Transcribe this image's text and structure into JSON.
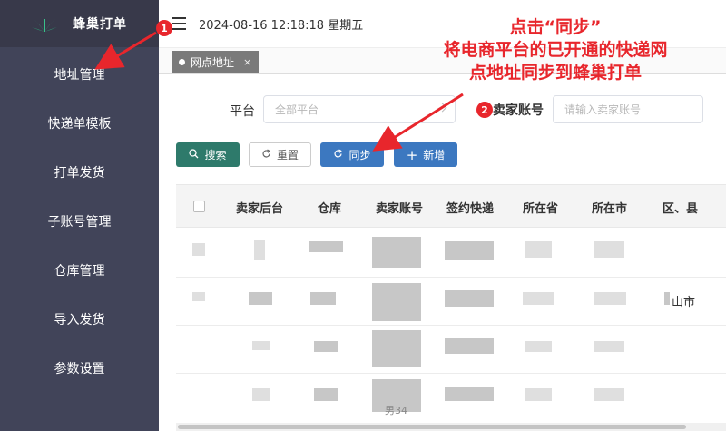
{
  "app": {
    "brand": "蜂巢打单",
    "datetime": "2024-08-16 12:18:18 星期五"
  },
  "sidebar": {
    "items": [
      {
        "label": "地址管理"
      },
      {
        "label": "快递单模板"
      },
      {
        "label": "打单发货"
      },
      {
        "label": "子账号管理"
      },
      {
        "label": "仓库管理"
      },
      {
        "label": "导入发货"
      },
      {
        "label": "参数设置"
      }
    ]
  },
  "tabs": [
    {
      "label": "网点地址",
      "close": "×"
    }
  ],
  "filters": {
    "platform_label": "平台",
    "platform_placeholder": "全部平台",
    "seller_label": "卖家账号",
    "seller_placeholder": "请输入卖家账号"
  },
  "toolbar": {
    "search": "搜索",
    "reset": "重置",
    "sync": "同步",
    "add": "新增"
  },
  "table": {
    "columns": [
      "卖家后台",
      "仓库",
      "卖家账号",
      "签约快递",
      "所在省",
      "所在市",
      "区、县"
    ],
    "rows": [
      {
        "district": ""
      },
      {
        "district": "山市"
      },
      {
        "district": ""
      },
      {
        "district": ""
      }
    ],
    "footer_partial": "男34"
  },
  "annotation": {
    "line1": "点击“同步”",
    "line2": "将电商平台的已开通的快递网",
    "line3": "点地址同步到蜂巢打单",
    "badge1": "1",
    "badge2": "2",
    "color": "#e8262c"
  },
  "colors": {
    "sidebar": "#414459",
    "brand_bg": "#38394a",
    "search_btn": "#2e7a6b",
    "primary_btn": "#3c78c0"
  },
  "icons": {
    "logo": "leaf-logo",
    "menu": "hamburger-icon",
    "search": "search-icon",
    "reset": "refresh-icon",
    "sync": "sync-icon",
    "add": "plus-icon"
  }
}
